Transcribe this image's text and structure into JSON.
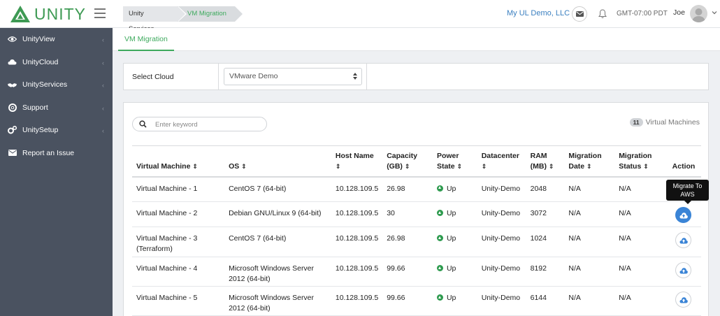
{
  "header": {
    "logo_text": "UNITY",
    "breadcrumbs": [
      "Unity Services",
      "VM Migration"
    ],
    "org": "My UL Demo, LLC",
    "timezone": "GMT-07:00 PDT",
    "user": "Joe"
  },
  "sidebar": {
    "items": [
      {
        "label": "UnityView",
        "icon": "eye-icon"
      },
      {
        "label": "UnityCloud",
        "icon": "cloud-icon"
      },
      {
        "label": "UnityServices",
        "icon": "handshake-icon"
      },
      {
        "label": "Support",
        "icon": "lifebuoy-icon"
      },
      {
        "label": "UnitySetup",
        "icon": "gears-icon"
      },
      {
        "label": "Report an Issue",
        "icon": "envelope-icon"
      }
    ]
  },
  "tabs": {
    "active": "VM Migration"
  },
  "cloud_select": {
    "label": "Select Cloud",
    "value": "VMware Demo"
  },
  "search": {
    "placeholder": "Enter keyword"
  },
  "vm_count": {
    "count": "11",
    "label": "Virtual Machines"
  },
  "table": {
    "headers": {
      "vm": "Virtual Machine",
      "os": "OS",
      "host_name": "Host Name",
      "capacity_1": "Capacity",
      "capacity_2": "(GB)",
      "power_1": "Power",
      "power_2": "State",
      "datacenter": "Datacenter",
      "ram_1": "RAM",
      "ram_2": "(MB)",
      "mig_date_1": "Migration",
      "mig_date_2": "Date",
      "mig_status_1": "Migration",
      "mig_status_2": "Status",
      "action": "Action"
    },
    "rows": [
      {
        "vm": "Virtual Machine - 1",
        "vm2": "",
        "os": "CentOS 7 (64-bit)",
        "os2": "",
        "host": "10.128.109.5",
        "capacity": "26.98",
        "power": "Up",
        "datacenter": "Unity-Demo",
        "ram": "2048",
        "date": "N/A",
        "status": "N/A"
      },
      {
        "vm": "Virtual Machine - 2",
        "vm2": "",
        "os": "Debian GNU/Linux 9 (64-bit)",
        "os2": "",
        "host": "10.128.109.5",
        "capacity": "30",
        "power": "Up",
        "datacenter": "Unity-Demo",
        "ram": "3072",
        "date": "N/A",
        "status": "N/A"
      },
      {
        "vm": "Virtual Machine - 3",
        "vm2": "(Terraform)",
        "os": "CentOS 7 (64-bit)",
        "os2": "",
        "host": "10.128.109.5",
        "capacity": "26.98",
        "power": "Up",
        "datacenter": "Unity-Demo",
        "ram": "1024",
        "date": "N/A",
        "status": "N/A"
      },
      {
        "vm": "Virtual Machine - 4",
        "vm2": "",
        "os": "Microsoft Windows Server",
        "os2": "2012 (64-bit)",
        "host": "10.128.109.5",
        "capacity": "99.66",
        "power": "Up",
        "datacenter": "Unity-Demo",
        "ram": "8192",
        "date": "N/A",
        "status": "N/A"
      },
      {
        "vm": "Virtual Machine - 5",
        "vm2": "",
        "os": "Microsoft Windows Server",
        "os2": "2012 (64-bit)",
        "host": "10.128.109.5",
        "capacity": "99.66",
        "power": "Up",
        "datacenter": "Unity-Demo",
        "ram": "6144",
        "date": "N/A",
        "status": "N/A"
      }
    ]
  },
  "tooltip": {
    "line1": "Migrate To",
    "line2": "AWS"
  },
  "colors": {
    "brand_green": "#3e9a54",
    "sidebar_bg": "#4a5260",
    "link_blue": "#3a7fc0",
    "accent_blue": "#3a84d6",
    "status_green": "#2e9b4f"
  }
}
